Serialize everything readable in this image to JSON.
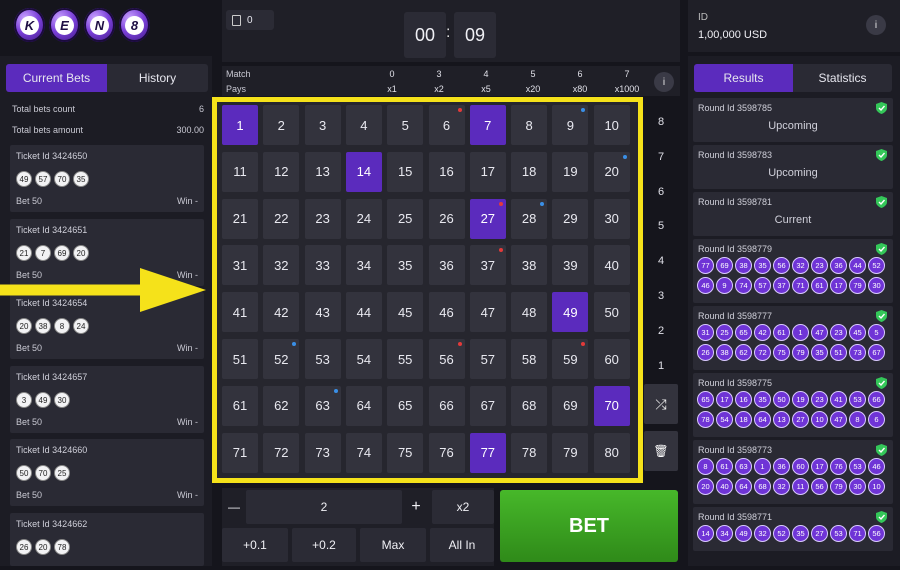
{
  "logo": {
    "letters": [
      "K",
      "E",
      "N",
      "8"
    ]
  },
  "left": {
    "tabs": [
      "Current Bets",
      "History"
    ],
    "total_bets_count_label": "Total bets count",
    "total_bets_count": "6",
    "total_bets_amount_label": "Total bets amount",
    "total_bets_amount": "300.00",
    "tickets": [
      {
        "id": "Ticket Id 3424650",
        "balls": [
          "49",
          "57",
          "70",
          "35"
        ],
        "bet": "Bet 50",
        "win": "Win -"
      },
      {
        "id": "Ticket Id 3424651",
        "balls": [
          "21",
          "7",
          "69",
          "20"
        ],
        "bet": "Bet 50",
        "win": "Win -"
      },
      {
        "id": "Ticket Id 3424654",
        "balls": [
          "20",
          "38",
          "8",
          "24"
        ],
        "bet": "Bet 50",
        "win": "Win -"
      },
      {
        "id": "Ticket Id 3424657",
        "balls": [
          "3",
          "49",
          "30"
        ],
        "bet": "Bet 50",
        "win": "Win -"
      },
      {
        "id": "Ticket Id 3424660",
        "balls": [
          "50",
          "70",
          "25"
        ],
        "bet": "Bet 50",
        "win": "Win -"
      },
      {
        "id": "Ticket Id 3424662",
        "balls": [
          "26",
          "20",
          "78"
        ],
        "bet": "",
        "win": ""
      }
    ]
  },
  "top": {
    "wallet_count": "0",
    "timer_min": "00",
    "timer_sec": "09",
    "colon": ":",
    "match_label": "Match",
    "pays_label": "Pays",
    "match_values": [
      "0",
      "3",
      "4",
      "5",
      "6",
      "7"
    ],
    "pays_values": [
      "x1",
      "x2",
      "x5",
      "x20",
      "x80",
      "x1000"
    ],
    "info": "i"
  },
  "grid": {
    "numbers": [
      1,
      2,
      3,
      4,
      5,
      6,
      7,
      8,
      9,
      10,
      11,
      12,
      13,
      14,
      15,
      16,
      17,
      18,
      19,
      20,
      21,
      22,
      23,
      24,
      25,
      26,
      27,
      28,
      29,
      30,
      31,
      32,
      33,
      34,
      35,
      36,
      37,
      38,
      39,
      40,
      41,
      42,
      43,
      44,
      45,
      46,
      47,
      48,
      49,
      50,
      51,
      52,
      53,
      54,
      55,
      56,
      57,
      58,
      59,
      60,
      61,
      62,
      63,
      64,
      65,
      66,
      67,
      68,
      69,
      70,
      71,
      72,
      73,
      74,
      75,
      76,
      77,
      78,
      79,
      80
    ],
    "selected": [
      1,
      7,
      14,
      27,
      49,
      70,
      77
    ],
    "red_dots": [
      6,
      27,
      37,
      56,
      59
    ],
    "blue_dots": [
      9,
      20,
      28,
      52,
      63
    ],
    "dot_red": "#e23a3a",
    "dot_blue": "#3a8fe6",
    "selected_color": "#5b2bbd",
    "highlight_border": "#f5e21a"
  },
  "side": {
    "numbers": [
      "8",
      "7",
      "6",
      "5",
      "4",
      "3",
      "2",
      "1"
    ],
    "shuffle_icon": "⤮",
    "trash_icon": "🗑"
  },
  "controls": {
    "minus": "—",
    "stake": "2",
    "plus": "+",
    "x2": "x2",
    "plus01": "+0.1",
    "plus02": "+0.2",
    "max": "Max",
    "all_in": "All In",
    "bet": "BET"
  },
  "right": {
    "id_label": "ID",
    "balance": "1,00,000 USD",
    "info": "i",
    "tabs": [
      "Results",
      "Statistics"
    ],
    "rounds": [
      {
        "id": "Round Id 3598785",
        "status": "Upcoming",
        "balls": []
      },
      {
        "id": "Round Id 3598783",
        "status": "Upcoming",
        "balls": []
      },
      {
        "id": "Round Id 3598781",
        "status": "Current",
        "balls": []
      },
      {
        "id": "Round Id 3598779",
        "status": "",
        "balls": [
          "77",
          "69",
          "38",
          "35",
          "56",
          "32",
          "23",
          "36",
          "44",
          "52",
          "46",
          "9",
          "74",
          "57",
          "37",
          "71",
          "61",
          "17",
          "79",
          "30"
        ]
      },
      {
        "id": "Round Id 3598777",
        "status": "",
        "balls": [
          "31",
          "25",
          "65",
          "42",
          "61",
          "1",
          "47",
          "23",
          "45",
          "5",
          "26",
          "38",
          "62",
          "72",
          "75",
          "79",
          "35",
          "51",
          "73",
          "67"
        ]
      },
      {
        "id": "Round Id 3598775",
        "status": "",
        "balls": [
          "65",
          "17",
          "16",
          "35",
          "50",
          "19",
          "23",
          "41",
          "53",
          "66",
          "78",
          "54",
          "18",
          "64",
          "13",
          "27",
          "10",
          "47",
          "8",
          "6"
        ]
      },
      {
        "id": "Round Id 3598773",
        "status": "",
        "balls": [
          "8",
          "61",
          "63",
          "1",
          "36",
          "60",
          "17",
          "76",
          "53",
          "46",
          "20",
          "40",
          "64",
          "68",
          "32",
          "11",
          "56",
          "79",
          "30",
          "10"
        ]
      },
      {
        "id": "Round Id 3598771",
        "status": "",
        "balls": [
          "14",
          "34",
          "49",
          "32",
          "52",
          "35",
          "27",
          "53",
          "71",
          "56"
        ]
      }
    ]
  }
}
